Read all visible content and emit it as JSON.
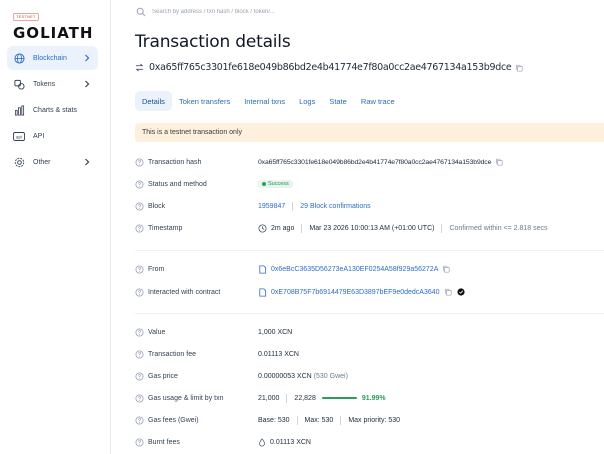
{
  "brand": {
    "tag": "TESTNET",
    "name": "GOLIATH"
  },
  "sidebar": {
    "items": [
      {
        "label": "Blockchain",
        "icon": "globe-icon",
        "active": true,
        "chevron": true
      },
      {
        "label": "Tokens",
        "icon": "tokens-icon",
        "active": false,
        "chevron": true
      },
      {
        "label": "Charts & stats",
        "icon": "chart-icon",
        "active": false,
        "chevron": false
      },
      {
        "label": "API",
        "icon": "api-icon",
        "active": false,
        "chevron": false
      },
      {
        "label": "Other",
        "icon": "gear-icon",
        "active": false,
        "chevron": true
      }
    ]
  },
  "search": {
    "placeholder": "Search by address / txn hash / block / token/..."
  },
  "page": {
    "title": "Transaction details",
    "hash": "0xa65ff765c3301fe618e049b86bd2e4b41774e7f80a0cc2ae4767134a153b9dce"
  },
  "tabs": [
    "Details",
    "Token transfers",
    "Internal txns",
    "Logs",
    "State",
    "Raw trace"
  ],
  "notice": "This is a testnet transaction only",
  "details": {
    "tx_hash": {
      "label": "Transaction hash",
      "value": "0xa65ff765c3301fe618e049b86bd2e4b41774e7f80a0cc2ae4767134a153b9dce"
    },
    "status": {
      "label": "Status and method",
      "value": "Success"
    },
    "block": {
      "label": "Block",
      "number": "1959847",
      "confirmations": "29 Block confirmations"
    },
    "timestamp": {
      "label": "Timestamp",
      "ago": "2m ago",
      "date": "Mar 23 2026 10:00:13 AM (+01:00 UTC)",
      "confirmed": "Confirmed within <= 2.818 secs"
    },
    "from": {
      "label": "From",
      "value": "0x6eBcC3635D56273eA130EF0254A58f929a56272A"
    },
    "to": {
      "label": "Interacted with contract",
      "value": "0xE708B75F7b6914479E63D3897bEF9e0dedcA3640"
    },
    "value": {
      "label": "Value",
      "value": "1,000 XCN"
    },
    "fee": {
      "label": "Transaction fee",
      "value": "0.01113 XCN"
    },
    "gas_price": {
      "label": "Gas price",
      "value": "0.00000053 XCN",
      "gwei": "(530 Gwei)"
    },
    "gas_usage": {
      "label": "Gas usage & limit by txn",
      "used": "21,000",
      "limit": "22,828",
      "percent": "91.99%",
      "fraction": 0.9199
    },
    "gas_fees": {
      "label": "Gas fees (Gwei)",
      "base": "Base: 530",
      "max": "Max: 530",
      "priority": "Max priority: 530"
    },
    "burnt": {
      "label": "Burnt fees",
      "value": "0.01113 XCN"
    }
  },
  "colors": {
    "accent": "#2c6ec4",
    "success": "#23a35a",
    "notice_bg": "#fdf0dc"
  }
}
